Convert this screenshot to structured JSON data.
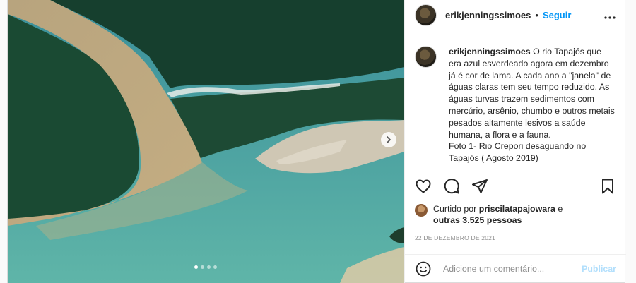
{
  "post": {
    "username": "erikjenningssimoes",
    "separator": "•",
    "follow_label": "Seguir",
    "more_label": "•••"
  },
  "caption": {
    "username": "erikjenningssimoes",
    "text": " O rio Tapajós que era azul esverdeado agora em dezembro já é cor de lama. A cada ano a \"janela\" de águas claras tem seu tempo reduzido. As águas turvas trazem sedimentos com mercúrio, arsênio, chumbo e outros metais pesados altamente lesivos a saúde humana, a flora e a fauna.",
    "text2": "Foto 1- Rio Crepori desaguando no Tapajós ( Agosto 2019)"
  },
  "likes": {
    "prefix": "Curtido por ",
    "user": "priscilatapajowara",
    "conj": " e",
    "others": "outras 3.525 pessoas"
  },
  "date": "22 DE DEZEMBRO DE 2021",
  "comment": {
    "placeholder": "Adicione um comentário...",
    "publish_label": "Publicar"
  },
  "carousel": {
    "slide_count": 4,
    "active_index": 0
  },
  "icons": {
    "like": "heart-icon",
    "comment": "comment-bubble-icon",
    "share": "paper-plane-icon",
    "save": "bookmark-icon",
    "next": "chevron-right-icon",
    "emoji": "smiley-icon"
  }
}
